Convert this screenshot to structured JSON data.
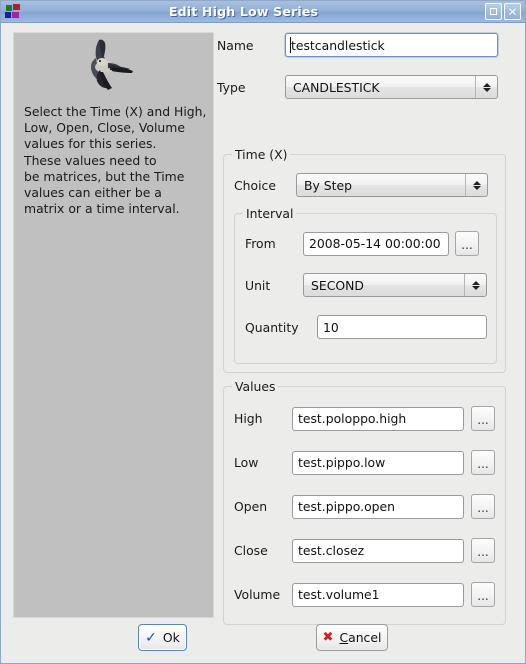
{
  "window": {
    "title": "Edit High Low Series",
    "icon": "app-squares-icon",
    "buttons": {
      "maximize": "maximize-icon",
      "close": "close-icon"
    }
  },
  "info_panel": {
    "image": "bird-in-flight-image",
    "text": "Select the Time (X) and High,\nLow, Open, Close, Volume\nvalues for this series.\nThese values need to\nbe matrices, but the Time\nvalues can either be a\nmatrix or a time interval."
  },
  "form": {
    "name": {
      "label": "Name",
      "value": "testcandlestick"
    },
    "type": {
      "label": "Type",
      "value": "CANDLESTICK"
    },
    "time_group": {
      "title": "Time (X)",
      "choice": {
        "label": "Choice",
        "value": "By Step"
      },
      "interval_group": {
        "title": "Interval",
        "from": {
          "label": "From",
          "value": "2008-05-14 00:00:00",
          "browse": "..."
        },
        "unit": {
          "label": "Unit",
          "value": "SECOND"
        },
        "quantity": {
          "label": "Quantity",
          "value": "10"
        }
      }
    },
    "values_group": {
      "title": "Values",
      "rows": [
        {
          "label": "High",
          "value": "test.poloppo.high",
          "browse": "..."
        },
        {
          "label": "Low",
          "value": "test.pippo.low",
          "browse": "..."
        },
        {
          "label": "Open",
          "value": "test.pippo.open",
          "browse": "..."
        },
        {
          "label": "Close",
          "value": "test.closez",
          "browse": "..."
        },
        {
          "label": "Volume",
          "value": "test.volume1",
          "browse": "..."
        }
      ]
    }
  },
  "actions": {
    "ok": "Ok",
    "cancel_prefix": "C",
    "cancel_rest": "ancel",
    "ok_icon": "check-icon",
    "cancel_icon": "x-icon"
  },
  "colors": {
    "titlebar_blue": "#93b0d8",
    "panel_gray": "#c0c0c0",
    "dialog_bg": "#ececeb",
    "ok_check": "#1945c8",
    "cancel_x": "#d11f1f"
  }
}
